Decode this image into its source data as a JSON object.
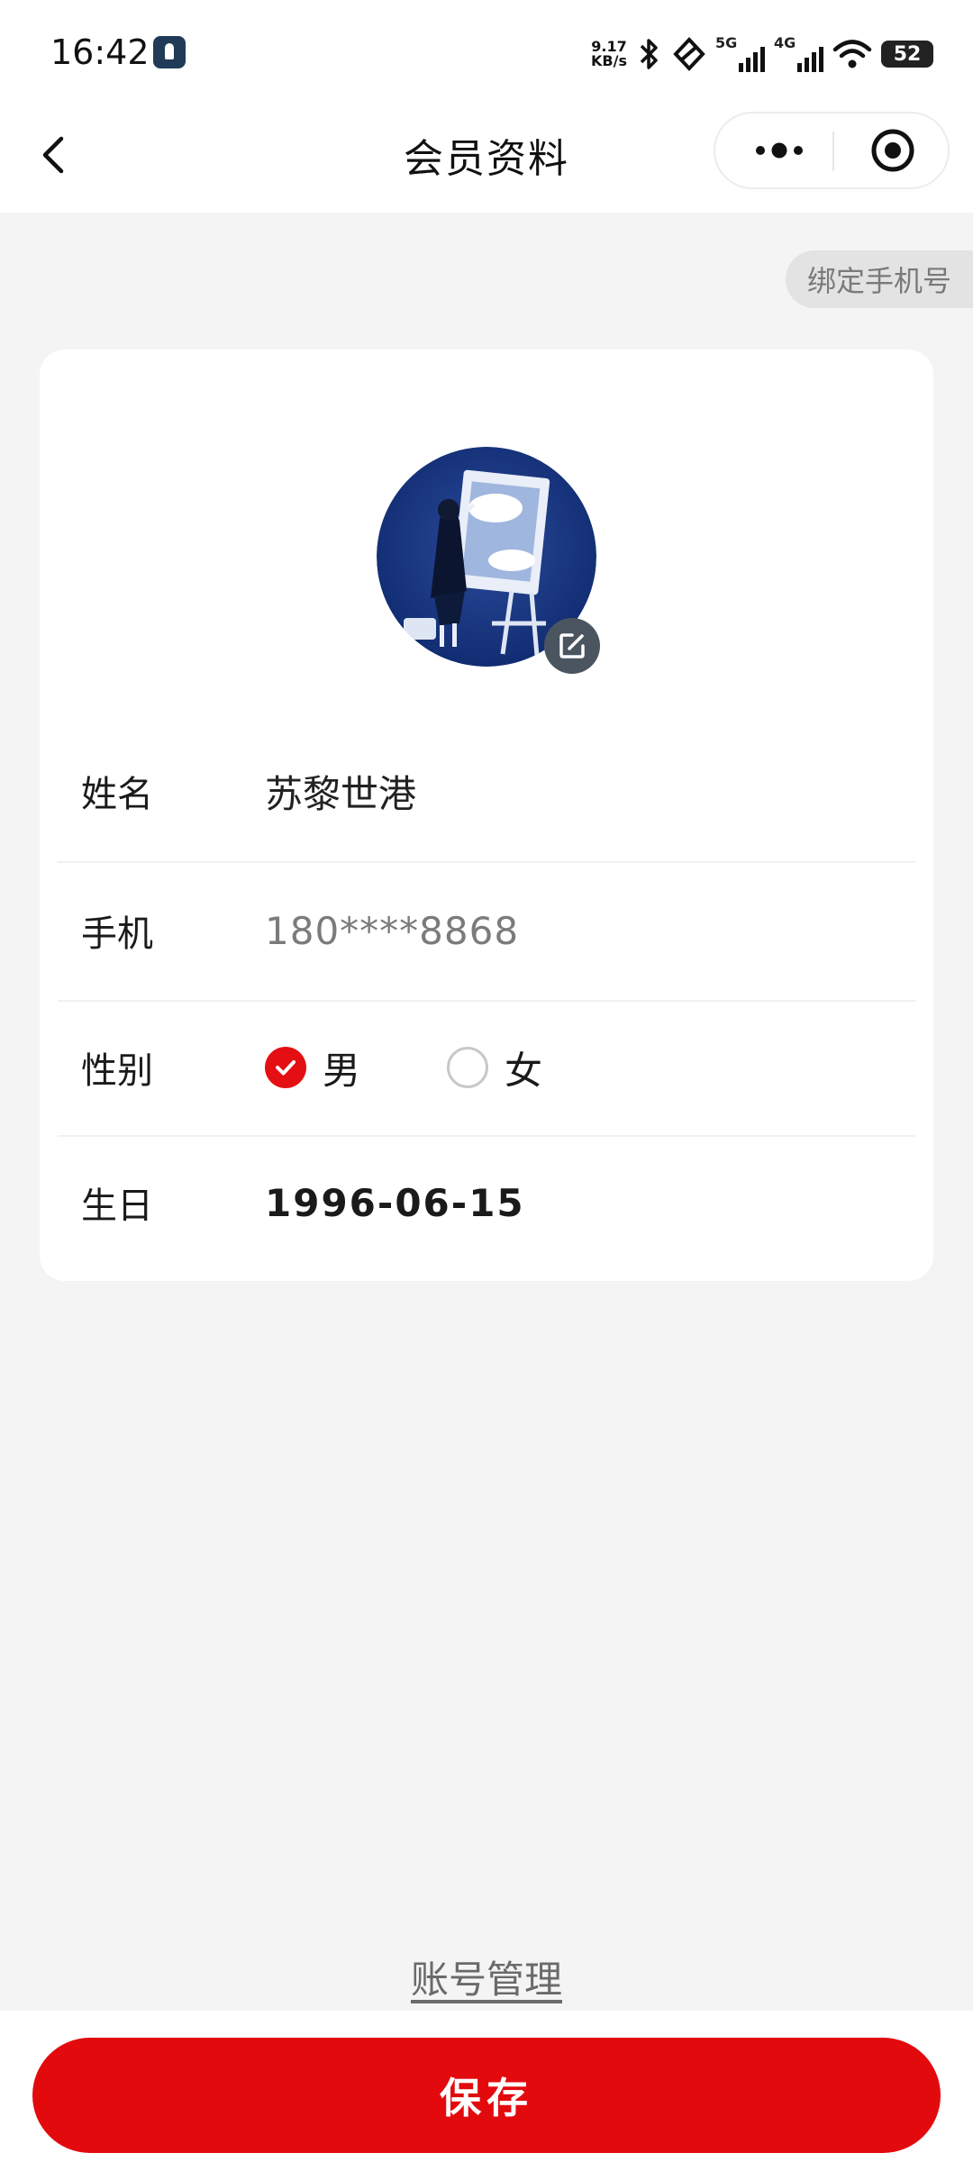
{
  "status_bar": {
    "time": "16:42",
    "net_speed_value": "9.17",
    "net_speed_unit": "KB/s",
    "signal_1": "5G",
    "signal_2": "4G",
    "battery": "52",
    "icons": [
      "app-notification-icon",
      "bluetooth-icon",
      "nfc-icon",
      "signal-5g-icon",
      "signal-4g-icon",
      "wifi-icon",
      "battery-icon"
    ]
  },
  "navbar": {
    "title": "会员资料",
    "back_icon": "chevron-left-icon",
    "more_icon": "more-dots-icon",
    "close_icon": "target-close-icon"
  },
  "bind_phone_label": "绑定手机号",
  "profile": {
    "avatar_icon": "avatar-image",
    "edit_icon": "edit-icon",
    "fields": {
      "name_label": "姓名",
      "name_value": "苏黎世港",
      "phone_label": "手机",
      "phone_value": "180****8868",
      "gender_label": "性别",
      "gender_options": [
        "男",
        "女"
      ],
      "gender_selected": "男",
      "birthday_label": "生日",
      "birthday_value": "1996-06-15"
    }
  },
  "account_link": "账号管理",
  "save_button": "保存",
  "colors": {
    "accent": "#e30a0e",
    "background": "#f4f4f4",
    "card": "#ffffff",
    "tag_bg": "#e3e3e3"
  }
}
